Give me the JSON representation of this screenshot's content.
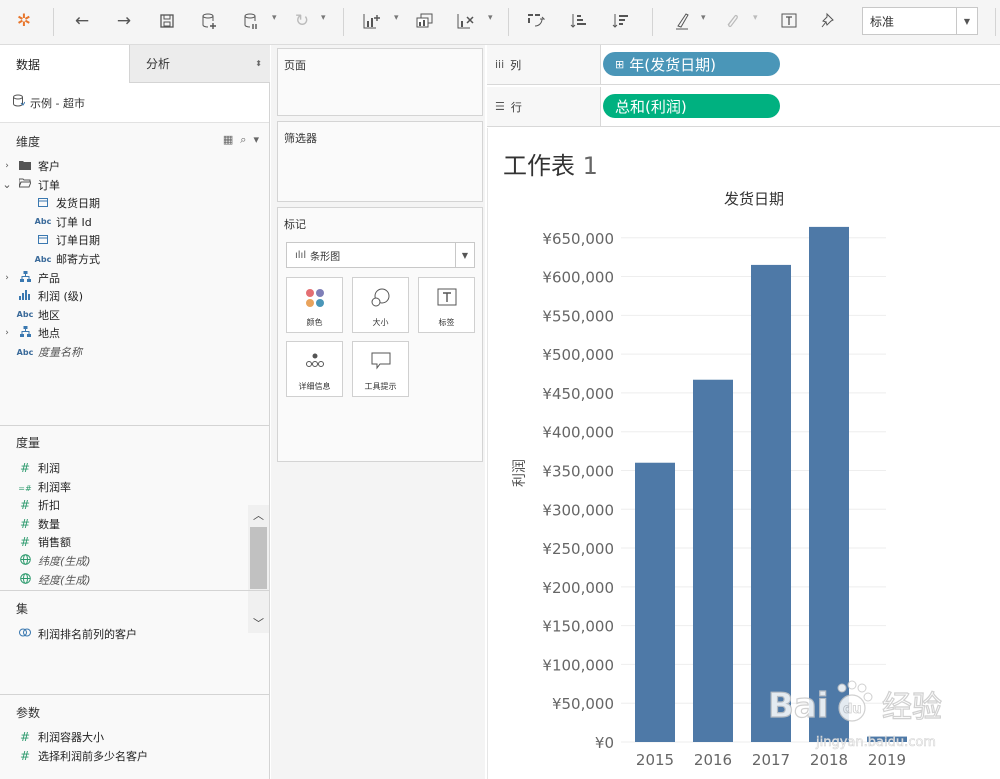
{
  "toolbar": {
    "fit_value": "标准"
  },
  "data_pane": {
    "tab_data": "数据",
    "tab_analysis": "分析",
    "datasource": "示例 - 超市",
    "dimensions_header": "维度",
    "dimensions": [
      {
        "label": "客户",
        "type": "folder",
        "expand": "›"
      },
      {
        "label": "订单",
        "type": "folder-open",
        "expand": "⌄"
      },
      {
        "label": "发货日期",
        "type": "date",
        "indent": true
      },
      {
        "label": "订单 Id",
        "type": "abc",
        "indent": true
      },
      {
        "label": "订单日期",
        "type": "date",
        "indent": true
      },
      {
        "label": "邮寄方式",
        "type": "abc",
        "indent": true
      },
      {
        "label": "产品",
        "type": "hierarchy",
        "expand": "›"
      },
      {
        "label": "利润 (级)",
        "type": "bin"
      },
      {
        "label": "地区",
        "type": "abc"
      },
      {
        "label": "地点",
        "type": "hierarchy",
        "expand": "›"
      },
      {
        "label": "度量名称",
        "type": "abc",
        "italic": true
      }
    ],
    "measures_header": "度量",
    "measures": [
      {
        "label": "利润",
        "type": "measure"
      },
      {
        "label": "利润率",
        "type": "calc"
      },
      {
        "label": "折扣",
        "type": "measure"
      },
      {
        "label": "数量",
        "type": "measure"
      },
      {
        "label": "销售额",
        "type": "measure"
      },
      {
        "label": "纬度(生成)",
        "type": "globe",
        "italic": true
      },
      {
        "label": "经度(生成)",
        "type": "globe",
        "italic": true
      }
    ],
    "sets_header": "集",
    "sets": [
      {
        "label": "利润排名前列的客户"
      }
    ],
    "params_header": "参数",
    "params": [
      {
        "label": "利润容器大小"
      },
      {
        "label": "选择利润前多少名客户"
      }
    ]
  },
  "cards": {
    "pages": "页面",
    "filters": "筛选器",
    "marks": "标记",
    "mark_type": "条形图",
    "mark_buttons": [
      "颜色",
      "大小",
      "标签",
      "详细信息",
      "工具提示"
    ]
  },
  "shelves": {
    "columns_label": "列",
    "rows_label": "行",
    "columns_pill": "年(发货日期)",
    "rows_pill": "总和(利润)"
  },
  "view": {
    "sheet_title": "工作表",
    "sheet_number": "1"
  },
  "watermark": {
    "text": "Bai 经验",
    "sub": "jingyan.baidu.com"
  },
  "colors": {
    "bar": "#4e79a7",
    "pill_columns": "#4a96b8",
    "pill_rows": "#00b180"
  },
  "chart_data": {
    "type": "bar",
    "title": "发货日期",
    "ylabel": "利润",
    "xlabel": "",
    "categories": [
      "2015",
      "2016",
      "2017",
      "2018",
      "2019"
    ],
    "values": [
      360000,
      467000,
      615000,
      664000,
      7000
    ],
    "ylim": [
      0,
      660000
    ],
    "yticks": [
      {
        "v": 0,
        "label": "¥0"
      },
      {
        "v": 50000,
        "label": "¥50,000"
      },
      {
        "v": 100000,
        "label": "¥100,000"
      },
      {
        "v": 150000,
        "label": "¥150,000"
      },
      {
        "v": 200000,
        "label": "¥200,000"
      },
      {
        "v": 250000,
        "label": "¥250,000"
      },
      {
        "v": 300000,
        "label": "¥300,000"
      },
      {
        "v": 350000,
        "label": "¥350,000"
      },
      {
        "v": 400000,
        "label": "¥400,000"
      },
      {
        "v": 450000,
        "label": "¥450,000"
      },
      {
        "v": 500000,
        "label": "¥500,000"
      },
      {
        "v": 550000,
        "label": "¥550,000"
      },
      {
        "v": 600000,
        "label": "¥600,000"
      },
      {
        "v": 650000,
        "label": "¥650,000"
      }
    ],
    "grid": true
  }
}
